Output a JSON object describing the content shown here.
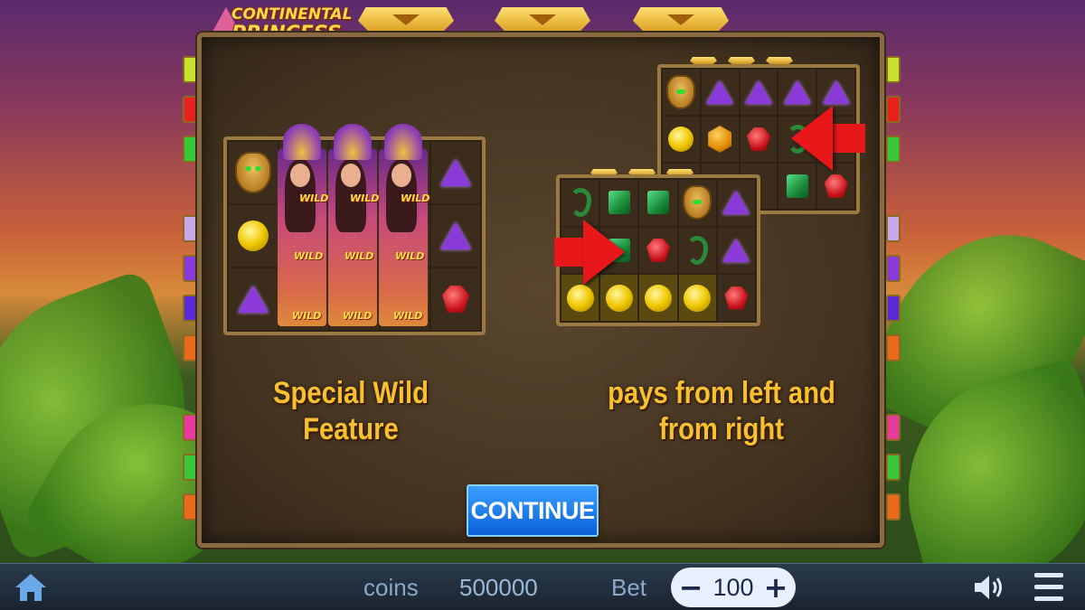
{
  "game": {
    "title_line1": "CONTINENTAL",
    "title_line2": "PRINCESS"
  },
  "info_panel": {
    "left_caption_line1": "Special Wild",
    "left_caption_line2": "Feature",
    "right_caption_line1": "pays from left and",
    "right_caption_line2": "from right",
    "wild_label": "WILD",
    "continue_label": "CONTINUE"
  },
  "bottom_bar": {
    "coins_label": "coins",
    "coins_value": "500000",
    "bet_label": "Bet",
    "bet_value": "100",
    "bet_minus": "−",
    "bet_plus": "+"
  },
  "icons": [
    "home-icon",
    "sound-icon",
    "menu-icon"
  ],
  "colors": {
    "caption": "#f8c030",
    "continue_bg": "#1a7ae8",
    "arrow": "#e8181a",
    "bottom_bar": "#1e2a36"
  }
}
